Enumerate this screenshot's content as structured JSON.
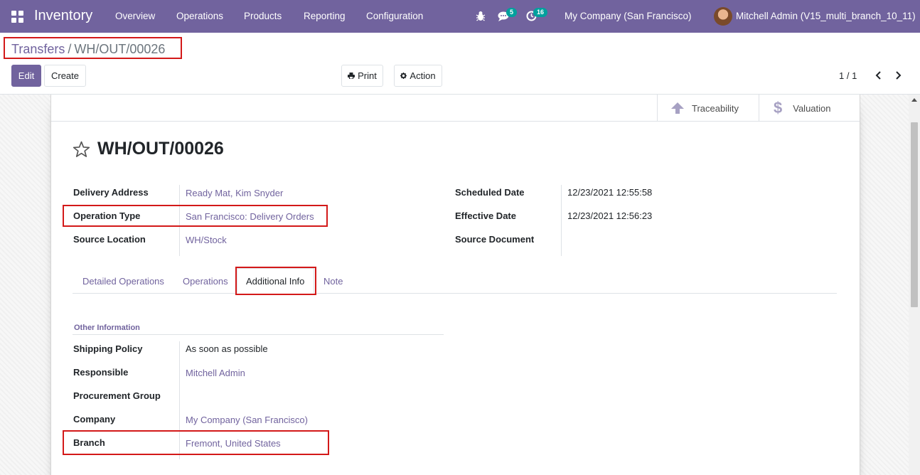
{
  "navbar": {
    "app_name": "Inventory",
    "menu": [
      "Overview",
      "Operations",
      "Products",
      "Reporting",
      "Configuration"
    ],
    "messages_count": "5",
    "activities_count": "16",
    "company": "My Company (San Francisco)",
    "user": "Mitchell Admin (V15_multi_branch_10_11)",
    "color": "#71639e"
  },
  "breadcrumb": {
    "parent": "Transfers",
    "separator": "/",
    "current": "WH/OUT/00026"
  },
  "toolbar": {
    "edit_label": "Edit",
    "create_label": "Create",
    "print_label": "Print",
    "action_label": "Action",
    "pager": "1 / 1"
  },
  "smart_buttons": {
    "traceability": "Traceability",
    "valuation": "Valuation"
  },
  "record": {
    "title": "WH/OUT/00026",
    "left_fields": [
      {
        "label": "Delivery Address",
        "value": "Ready Mat, Kim Snyder"
      },
      {
        "label": "Operation Type",
        "value": "San Francisco: Delivery Orders"
      },
      {
        "label": "Source Location",
        "value": "WH/Stock"
      }
    ],
    "right_fields": [
      {
        "label": "Scheduled Date",
        "value": "12/23/2021 12:55:58"
      },
      {
        "label": "Effective Date",
        "value": "12/23/2021 12:56:23"
      },
      {
        "label": "Source Document",
        "value": ""
      }
    ]
  },
  "tabs": [
    "Detailed Operations",
    "Operations",
    "Additional Info",
    "Note"
  ],
  "additional_info": {
    "group_title": "Other Information",
    "fields": [
      {
        "label": "Shipping Policy",
        "value": "As soon as possible"
      },
      {
        "label": "Responsible",
        "value": "Mitchell Admin"
      },
      {
        "label": "Procurement Group",
        "value": ""
      },
      {
        "label": "Company",
        "value": "My Company (San Francisco)"
      },
      {
        "label": "Branch",
        "value": "Fremont, United States"
      }
    ]
  }
}
